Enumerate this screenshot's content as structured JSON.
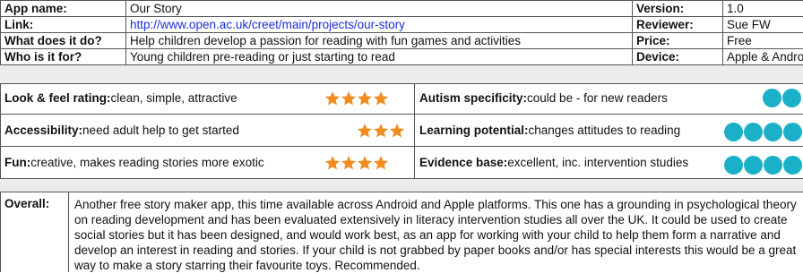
{
  "info": {
    "app_name_label": "App name:",
    "app_name": "Our Story",
    "link_label": "Link:",
    "link": "http://www.open.ac.uk/creet/main/projects/our-story",
    "what_label": "What does it do?",
    "what": "Help children develop a passion for reading with fun games and activities",
    "who_label": "Who is it for?",
    "who": "Young children pre-reading or just starting to read",
    "version_label": "Version:",
    "version": "1.0",
    "reviewer_label": "Reviewer:",
    "reviewer": "Sue FW",
    "price_label": "Price:",
    "price": "Free",
    "device_label": "Device:",
    "device": "Apple & Android"
  },
  "ratings": {
    "look_label": "Look & feel rating:",
    "look_text": " clean, simple, attractive",
    "look_stars": 4,
    "access_label": "Accessibility:",
    "access_text": " need adult help to get started",
    "access_stars": 3,
    "fun_label": "Fun:",
    "fun_text": " creative, makes reading stories more exotic",
    "fun_stars": 4,
    "autism_label": "Autism specificity:",
    "autism_text": " could be - for new readers",
    "autism_dots": 2,
    "learning_label": "Learning potential:",
    "learning_text": " changes attitudes to reading",
    "learning_dots": 4,
    "evidence_label": "Evidence base:",
    "evidence_text": " excellent, inc. intervention studies",
    "evidence_dots": 4
  },
  "overall": {
    "label": "Overall:",
    "text": "Another free story maker app, this time available across Android and Apple platforms. This one has a grounding in psychological theory on reading development and has been evaluated extensively in literacy intervention studies all over the UK. It could be used to create social stories but it has been designed, and would work best, as an app for working with your child to help them form a narrative and develop an interest in reading and stories. If your child is not grabbed by paper books and/or has special interests this would be a great way to make a story starring their favourite toys. Recommended."
  },
  "colors": {
    "star": "#f28c1e",
    "dot": "#1ab0c8",
    "link": "#1a2fd6",
    "gap": "#ececec"
  }
}
